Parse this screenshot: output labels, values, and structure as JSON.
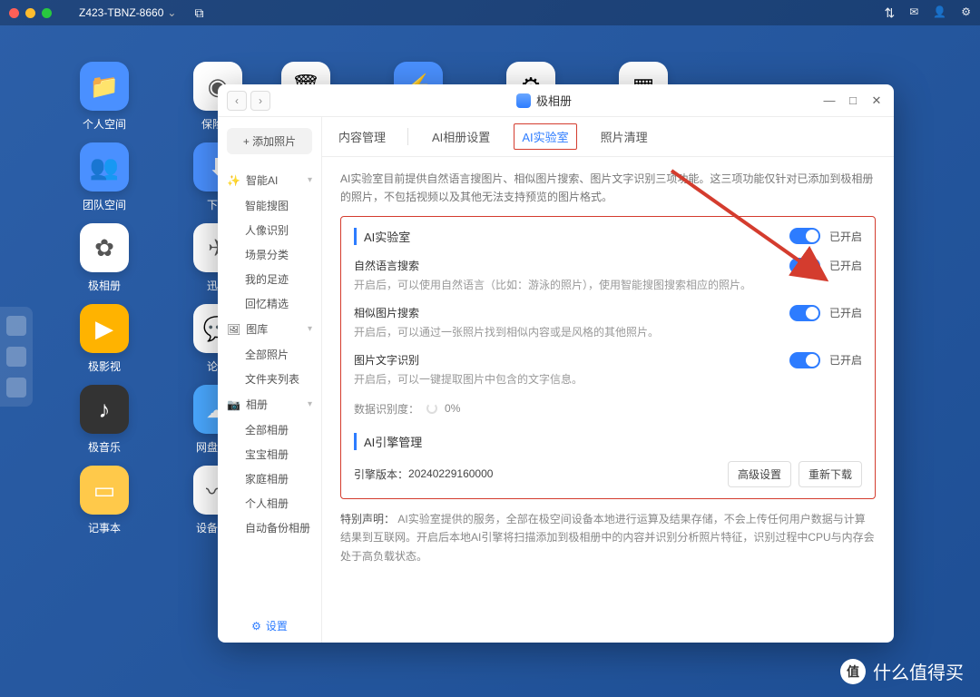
{
  "topbar": {
    "device": "Z423-TBNZ-8660"
  },
  "desktop_col1": [
    {
      "icon": "📁",
      "color": "#4a90ff",
      "label": "个人空间"
    },
    {
      "icon": "👥",
      "color": "#4a90ff",
      "label": "团队空间"
    },
    {
      "icon": "✿",
      "color": "#fff",
      "label": "极相册"
    },
    {
      "icon": "▶",
      "color": "#ffb300",
      "label": "极影视"
    },
    {
      "icon": "♪",
      "color": "#333",
      "label": "极音乐"
    },
    {
      "icon": "▭",
      "color": "#ffc94a",
      "label": "记事本"
    }
  ],
  "desktop_col2": [
    {
      "icon": "◉",
      "color": "#fff",
      "label": "保险箱"
    },
    {
      "icon": "⬇",
      "color": "#4a90ff",
      "label": "下载"
    },
    {
      "icon": "✈",
      "color": "#fff",
      "label": "迅雷"
    },
    {
      "icon": "💬",
      "color": "#fff",
      "label": "论坛"
    },
    {
      "icon": "☁",
      "color": "#4aa8ff",
      "label": "网盘备份"
    },
    {
      "icon": "〰",
      "color": "#fff",
      "label": "设备监控"
    }
  ],
  "window": {
    "title": "极相册",
    "minimize": "—",
    "maximize": "□",
    "close": "✕"
  },
  "sidebar": {
    "add_photo": "+ 添加照片",
    "groups": [
      {
        "title": "智能AI",
        "icon": "✨",
        "items": [
          "智能搜图",
          "人像识别",
          "场景分类",
          "我的足迹",
          "回忆精选"
        ]
      },
      {
        "title": "图库",
        "icon": "🖼",
        "items": [
          "全部照片",
          "文件夹列表"
        ]
      },
      {
        "title": "相册",
        "icon": "📷",
        "items": [
          "全部相册",
          "宝宝相册",
          "家庭相册",
          "个人相册",
          "自动备份相册"
        ]
      }
    ],
    "settings": "设置"
  },
  "tabs": [
    "内容管理",
    "AI相册设置",
    "AI实验室",
    "照片清理"
  ],
  "active_tab": 2,
  "content": {
    "intro": "AI实验室目前提供自然语言搜图片、相似图片搜索、图片文字识别三项功能。这三项功能仅针对已添加到极相册的照片，不包括视频以及其他无法支持预览的图片格式。",
    "lab_title": "AI实验室",
    "lab_status": "已开启",
    "features": [
      {
        "title": "自然语言搜索",
        "desc": "开启后，可以使用自然语言（比如：游泳的照片），使用智能搜图搜索相应的照片。",
        "status": "已开启"
      },
      {
        "title": "相似图片搜索",
        "desc": "开启后，可以通过一张照片找到相似内容或是风格的其他照片。",
        "status": "已开启"
      },
      {
        "title": "图片文字识别",
        "desc": "开启后，可以一键提取图片中包含的文字信息。",
        "status": "已开启"
      }
    ],
    "progress_label": "数据识别度：",
    "progress_value": "0%",
    "engine_title": "AI引擎管理",
    "engine_version_label": "引擎版本：",
    "engine_version": "20240229160000",
    "btn_advanced": "高级设置",
    "btn_redownload": "重新下载",
    "disclaim_head": "特别声明：",
    "disclaim_body": "AI实验室提供的服务，全部在极空间设备本地进行运算及结果存储，不会上传任何用户数据与计算结果到互联网。开启后本地AI引擎将扫描添加到极相册中的内容并识别分析照片特征，识别过程中CPU与内存会处于高负载状态。"
  },
  "watermark": "什么值得买"
}
